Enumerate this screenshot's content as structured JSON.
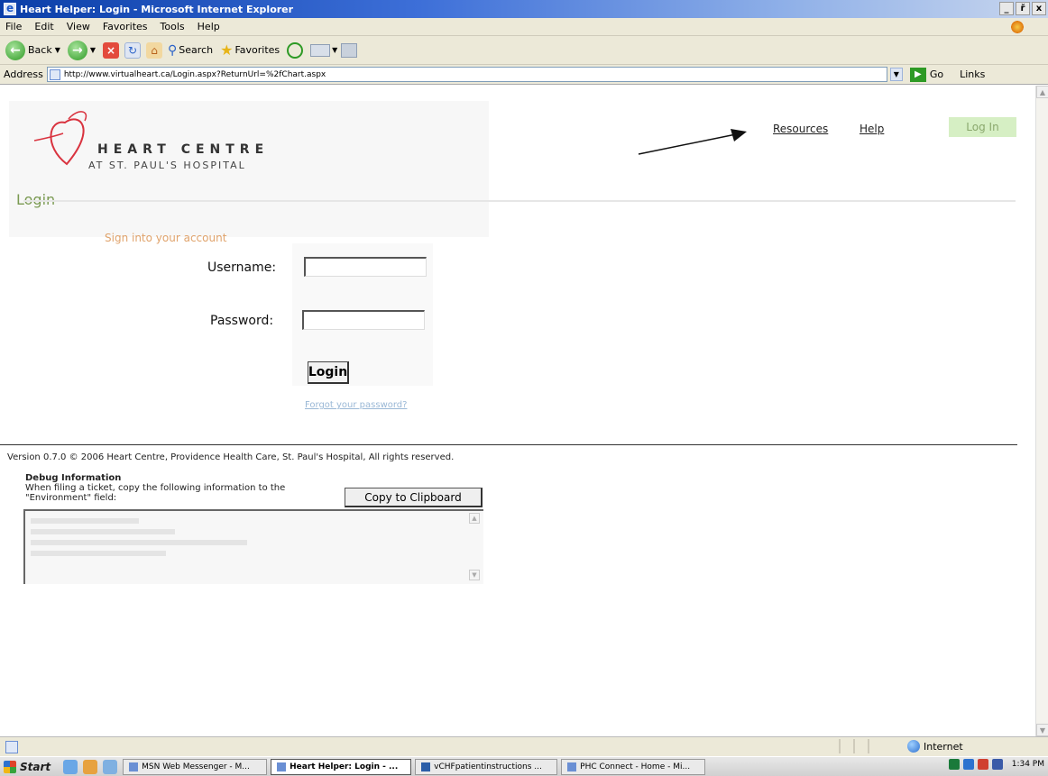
{
  "window": {
    "title": "Heart Helper: Login - Microsoft Internet Explorer",
    "controls": [
      "_",
      "ř",
      "x"
    ]
  },
  "menu": {
    "items": [
      "File",
      "Edit",
      "View",
      "Favorites",
      "Tools",
      "Help"
    ]
  },
  "toolbar": {
    "back_label": "Back",
    "search_label": "Search",
    "favorites_label": "Favorites"
  },
  "address": {
    "label": "Address",
    "url": "http://www.virtualheart.ca/Login.aspx?ReturnUrl=%2fChart.aspx",
    "go_label": "Go",
    "links_label": "Links"
  },
  "site": {
    "logo_name": "HEART CENTRE",
    "logo_sub": "AT ST. PAUL'S HOSPITAL",
    "page_title": "Login",
    "nav": {
      "resources": "Resources",
      "help": "Help",
      "login": "Log In"
    }
  },
  "form": {
    "subtitle": "Sign into your account",
    "username_label": "Username:",
    "password_label": "Password:",
    "username_value": "",
    "password_value": "",
    "submit_label": "Login",
    "forgot_link": "Forgot your password?"
  },
  "footer": {
    "version": "Version 0.7.0 © 2006 Heart Centre, Providence Health Care, St. Paul's Hospital, All rights reserved.",
    "debug_title": "Debug Information",
    "debug_desc": "When filing a ticket, copy the following information to the \"Environment\" field:",
    "copy_button": "Copy to Clipboard"
  },
  "status": {
    "zone": "Internet"
  },
  "taskbar": {
    "start": "Start",
    "tasks": [
      "MSN Web Messenger - M...",
      "Heart Helper: Login - ...",
      "vCHFpatientinstructions ...",
      "PHC Connect - Home - Mi..."
    ],
    "active_task_index": 1,
    "clock": "1:34 PM"
  },
  "colors": {
    "accent_green": "#7a9a52",
    "login_button_bg": "#d6efc4",
    "subtitle_orange": "#e0a36c",
    "link_blue": "#9ab8d6",
    "heart_red": "#d9333f"
  },
  "annotation": {
    "arrow_target": "nav-resources"
  }
}
